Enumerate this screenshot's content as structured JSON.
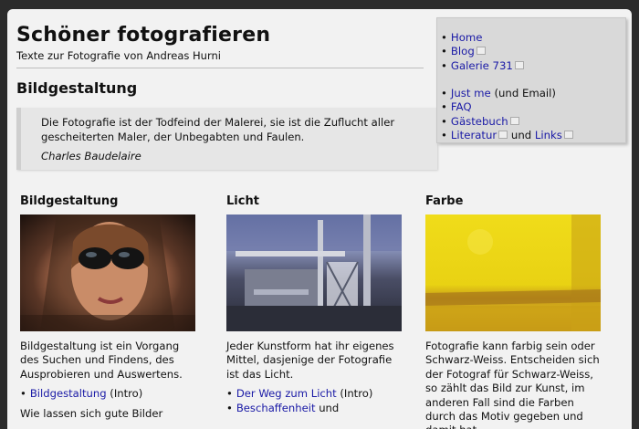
{
  "site": {
    "title": "Schöner fotografieren",
    "subtitle": "Texte zur Fotografie von Andreas Hurni"
  },
  "section_title": "Bildgestaltung",
  "quote": {
    "text": "Die Fotografie ist der Todfeind der Malerei, sie ist die Zuflucht aller gescheiterten Maler, der Unbegabten und Faulen.",
    "author": "Charles Baudelaire"
  },
  "nav": {
    "home": "Home",
    "blog": "Blog",
    "galerie": "Galerie 731",
    "justme": "Just me",
    "justme_suffix": " (und Email)",
    "faq": "FAQ",
    "gaestebuch": "Gästebuch",
    "literatur": "Literatur",
    "und": " und ",
    "links": "Links"
  },
  "columns": [
    {
      "title": "Bildgestaltung",
      "text": "Bildgestaltung ist ein Vorgang des Suchen und Findens, des Ausprobieren und Auswertens.",
      "items": [
        {
          "link": "Bildgestaltung",
          "suffix": " (Intro)"
        }
      ],
      "trailing": "Wie lassen sich gute Bilder"
    },
    {
      "title": "Licht",
      "text": "Jeder Kunstform hat ihr eigenes Mittel, dasjenige der Fotografie ist das Licht.",
      "items": [
        {
          "link": "Der Weg zum Licht",
          "suffix": " (Intro)"
        },
        {
          "link": "Beschaffenheit",
          "suffix": " und"
        }
      ]
    },
    {
      "title": "Farbe",
      "text": "Fotografie kann farbig sein oder Schwarz-Weiss. Entscheiden sich der Fotograf für Schwarz-Weiss, so zählt das Bild zur Kunst, im anderen Fall sind die Farben durch das Motiv gegeben und damit hat"
    }
  ]
}
